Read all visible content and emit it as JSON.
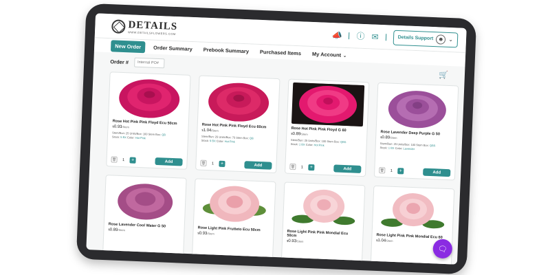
{
  "header": {
    "logo_name": "DETAILS",
    "logo_url": "WWW.DETAILSFLOWERS.COM",
    "support_label": "Details Support"
  },
  "nav": {
    "items": [
      {
        "label": "New Order"
      },
      {
        "label": "Order Summary"
      },
      {
        "label": "Prebook Summary"
      },
      {
        "label": "Purchased Items"
      },
      {
        "label": "My Account"
      }
    ]
  },
  "order": {
    "label": "Order #",
    "po_placeholder": "Internal PO#"
  },
  "products": [
    {
      "name": "Rose Hot Pink Pink Floyd Ecu 50cm",
      "price": "0.93",
      "unit": "/Stem",
      "stems": "25",
      "units": "100 Stem",
      "box": "QB",
      "stock": "5 BX",
      "color": "Hot Pink",
      "qty": "1",
      "add": "Add"
    },
    {
      "name": "Rose Hot Pink Pink Floyd Ecu 60cm",
      "price": "1.04",
      "unit": "/Stem",
      "stems": "25",
      "units": "75 Stem",
      "box": "QB",
      "stock": "9 BX",
      "color": "Hot Pink",
      "qty": "1",
      "add": "Add"
    },
    {
      "name": "Rose Hot Pink Pink Floyd G 60",
      "price": "0.89",
      "unit": "/Stem",
      "stems": "25",
      "units": "100 Stem",
      "box": "QBS",
      "stock": "1 BX",
      "color": "Hot Pink",
      "qty": "1",
      "add": "Add"
    },
    {
      "name": "Rose Lavender Deep Purple G 50",
      "price": "0.89",
      "unit": "/Stem",
      "stems": "25",
      "units": "100 Stem",
      "box": "QBS",
      "stock": "1 BX",
      "color": "Lavender",
      "qty": "1",
      "add": "Add"
    },
    {
      "name": "Rose Lavender Cool Water G 50",
      "price": "0.89",
      "unit": "/Stem"
    },
    {
      "name": "Rose Light Pink Frutteto Ecu 50cm",
      "price": "0.93",
      "unit": "/Stem"
    },
    {
      "name": "Rose Light Pink Pink Mondial Ecu 50cm",
      "price": "0.93",
      "unit": "/Stem"
    },
    {
      "name": "Rose Light Pink Pink Mondial Ecu 60",
      "price": "1.04",
      "unit": "/Stem"
    }
  ],
  "labels": {
    "currency": "$",
    "stems_label": "Stem/Bun:",
    "units_label": "Units/Box:",
    "box_label": "Box:",
    "stock_label": "Stock:",
    "color_label": "Color:"
  },
  "icons": {
    "megaphone": "megaphone-icon",
    "help": "help-icon",
    "mail": "mail-icon",
    "cart": "cart-icon",
    "chat": "chat-icon"
  },
  "colors": {
    "accent": "#2f8f8f",
    "chat": "#8a2be2",
    "rose_hot_pink": "#d81b6b",
    "rose_lavender": "#b06aa8",
    "rose_light_pink": "#f2b8c0"
  }
}
